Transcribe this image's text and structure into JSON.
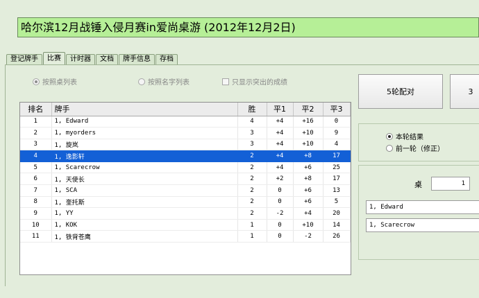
{
  "title": "哈尔滨12月战锤入侵月赛in爱尚桌游 (2012年12月2日)",
  "tabs": [
    "登记牌手",
    "比赛",
    "计时器",
    "文档",
    "牌手信息",
    "存档"
  ],
  "active_tab": "比赛",
  "list_options": {
    "by_table": "按照桌列表",
    "by_name": "按照名字列表",
    "highlight_only": "只显示突出的成绩"
  },
  "table": {
    "columns": [
      "排名",
      "牌手",
      "胜",
      "平1",
      "平2",
      "平3"
    ],
    "rows": [
      {
        "rank": "1",
        "player": "1, Edward",
        "win": "4",
        "t1": "+4",
        "t2": "+16",
        "t3": "0"
      },
      {
        "rank": "2",
        "player": "1, myorders",
        "win": "3",
        "t1": "+4",
        "t2": "+10",
        "t3": "9"
      },
      {
        "rank": "3",
        "player": "1, 旋岚",
        "win": "3",
        "t1": "+4",
        "t2": "+10",
        "t3": "4"
      },
      {
        "rank": "4",
        "player": "1, 逸影轩",
        "win": "2",
        "t1": "+4",
        "t2": "+8",
        "t3": "17"
      },
      {
        "rank": "5",
        "player": "1, Scarecrow",
        "win": "2",
        "t1": "+4",
        "t2": "+6",
        "t3": "25"
      },
      {
        "rank": "6",
        "player": "1, 天使长",
        "win": "2",
        "t1": "+2",
        "t2": "+8",
        "t3": "17"
      },
      {
        "rank": "7",
        "player": "1, SCA",
        "win": "2",
        "t1": "0",
        "t2": "+6",
        "t3": "13"
      },
      {
        "rank": "8",
        "player": "1, 奎托斯",
        "win": "2",
        "t1": "0",
        "t2": "+6",
        "t3": "5"
      },
      {
        "rank": "9",
        "player": "1, YY",
        "win": "2",
        "t1": "-2",
        "t2": "+4",
        "t3": "20"
      },
      {
        "rank": "10",
        "player": "1, KOK",
        "win": "1",
        "t1": "0",
        "t2": "+10",
        "t3": "14"
      },
      {
        "rank": "11",
        "player": "1, 铁背苍鹰",
        "win": "1",
        "t1": "0",
        "t2": "-2",
        "t3": "26"
      }
    ],
    "selected_rank": "4"
  },
  "buttons": {
    "pairing": "5轮配对",
    "second_partial": "3"
  },
  "round_options": {
    "current": "本轮结果",
    "previous": "前一轮（修正）"
  },
  "table_lookup": {
    "label": "桌",
    "value": "1",
    "player1": "1, Edward",
    "player2": "1, Scarecrow"
  }
}
